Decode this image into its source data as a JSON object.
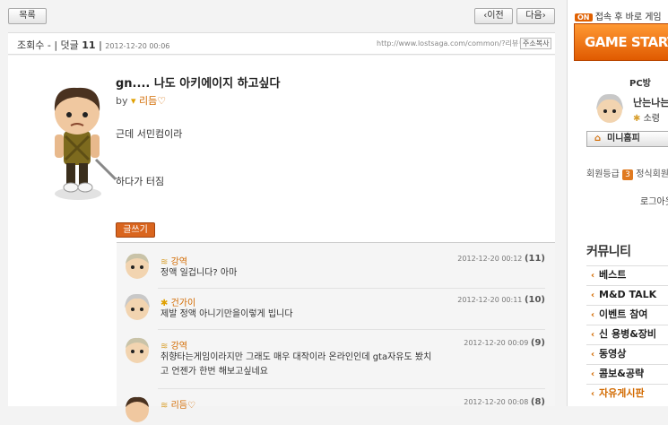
{
  "toolbar": {
    "list_label": "목록",
    "prev_label": "‹이전",
    "next_label": "다음›"
  },
  "info": {
    "prefix": "조회수 - | 덧글",
    "comment_count": "11",
    "separator": "|",
    "date": "2012-12-20 00:06",
    "url": "http://www.lostsaga.com/common/?리뷰♡",
    "copy_label": "주소복사"
  },
  "post": {
    "title": "gn.... 나도 아키에이지 하고싶다",
    "by_label": "by",
    "author": "리듬♡",
    "line1": "근데 서민컴이라",
    "line2": "하다가 터짐",
    "write_label": "글쓰기"
  },
  "comments": [
    {
      "name": "강역",
      "date": "2012-12-20 00:12",
      "num": "(11)",
      "text": "정액     일겁니다? 아마"
    },
    {
      "name": "건가이",
      "date": "2012-12-20 00:11",
      "num": "(10)",
      "text": "제발 정액      아니기만을이렇게 빕니다"
    },
    {
      "name": "강역",
      "date": "2012-12-20 00:09",
      "num": "(9)",
      "text": "취향타는게임이라지만 그래도 매우 대작이라 온라인인데 gta자유도 봤치",
      "text2": "고 언젠가 한번 해보고싶네요"
    },
    {
      "name": "리듬♡",
      "date": "2012-12-20 00:08",
      "num": "(8)",
      "text": ""
    }
  ],
  "sidebar": {
    "on_badge": "ON",
    "on_text": "접속 후 바로 게임",
    "game_start": "GAME START",
    "pcbang": "PC방",
    "profile_name": "난는나는",
    "profile_sub": "소령",
    "minihome": "미니홈피",
    "grade_label": "회원등급",
    "grade_num": "3",
    "grade_text": "정식회원",
    "logout": "로그아웃",
    "community_title": "커뮤니티",
    "menu": [
      "베스트",
      "M&D TALK",
      "이벤트 참여",
      "신 용병&장비",
      "동영상",
      "콤보&공략",
      "자유게시판"
    ]
  },
  "colors": {
    "accent": "#d26a00",
    "game_start": "#f07010",
    "write_button": "#d9651e"
  }
}
